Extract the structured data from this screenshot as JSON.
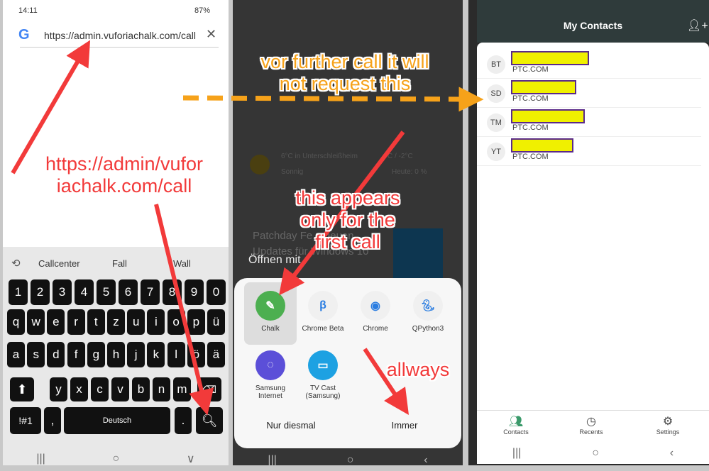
{
  "browser": {
    "time": "14:11",
    "battery": "87%",
    "url": "https://admin.vuforiachalk.com/call",
    "clear_icon": "close-icon"
  },
  "keyboard": {
    "suggestions": [
      "Callcenter",
      "Fall",
      "Wall"
    ],
    "rows": [
      [
        "1",
        "2",
        "3",
        "4",
        "5",
        "6",
        "7",
        "8",
        "9",
        "0"
      ],
      [
        "q",
        "w",
        "e",
        "r",
        "t",
        "z",
        "u",
        "i",
        "o",
        "p",
        "ü"
      ],
      [
        "a",
        "s",
        "d",
        "f",
        "g",
        "h",
        "j",
        "k",
        "l",
        "ö",
        "ä"
      ],
      [
        "y",
        "x",
        "c",
        "v",
        "b",
        "n",
        "m"
      ]
    ],
    "symbols": "!#1",
    "comma": ",",
    "space": "Deutsch",
    "period": "."
  },
  "chooser": {
    "weather_title": "6°C in Unterschleißheim",
    "weather_temp": "C / -2°C",
    "weather_state": "Sonnig",
    "weather_rain": "Heute: 0 %",
    "news": "Patchday Fe... neuen Updates für Windows 10",
    "title": "Öffnen mit",
    "apps": [
      {
        "label": "Chalk",
        "color": "#4caf50"
      },
      {
        "label": "Chrome Beta",
        "color": "#f0f0f0"
      },
      {
        "label": "Chrome",
        "color": "#f0f0f0"
      },
      {
        "label": "QPython3",
        "color": "#f0f0f0"
      },
      {
        "label": "Samsung Internet",
        "color": "#5b4fd8"
      },
      {
        "label": "TV Cast (Samsung)",
        "color": "#1da1e2"
      }
    ],
    "once": "Nur diesmal",
    "always": "Immer"
  },
  "contacts": {
    "title": "My Contacts",
    "items": [
      {
        "initials": "BT",
        "domain": "PTC.COM"
      },
      {
        "initials": "SD",
        "domain": "PTC.COM"
      },
      {
        "initials": "TM",
        "domain": "PTC.COM"
      },
      {
        "initials": "YT",
        "domain": "PTC.COM"
      }
    ],
    "tabs": [
      "Contacts",
      "Recents",
      "Settings"
    ]
  },
  "annotations": {
    "url": "https://admin/vufor iachalk.com/call",
    "further": "vor further call it will not request this",
    "first": "this appears only for the first call",
    "always": "allways"
  },
  "colors": {
    "annotation_red": "#f23a3a",
    "annotation_orange": "#f6a21a",
    "redaction": "#f0f000"
  }
}
